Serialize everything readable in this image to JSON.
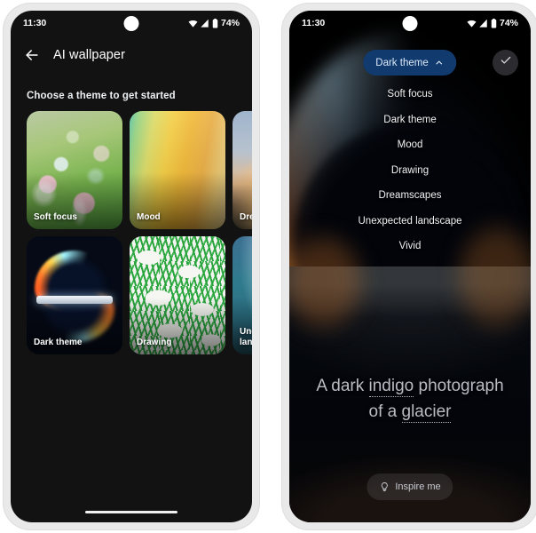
{
  "statusbar": {
    "time": "11:30",
    "battery": "74%",
    "icons": [
      "wifi-icon",
      "signal-icon",
      "battery-icon"
    ]
  },
  "left_phone": {
    "back_label": "back-arrow-icon",
    "title": "AI wallpaper",
    "subtitle": "Choose a theme to get started",
    "cards": [
      {
        "label": "Soft focus",
        "art": "art-soft"
      },
      {
        "label": "Mood",
        "art": "art-mood"
      },
      {
        "label": "Dream",
        "art": "art-dream"
      },
      {
        "label": "Dark theme",
        "art": "art-dark"
      },
      {
        "label": "Drawing",
        "art": "art-drawing"
      },
      {
        "label": "Unexpected\nlandsc",
        "art": "art-unexp"
      }
    ],
    "card_labels": {
      "c0": "Soft focus",
      "c1": "Mood",
      "c2": "Dream",
      "c3": "Dark theme",
      "c4": "Drawing",
      "c5a": "Unexp",
      "c5b": "lands"
    }
  },
  "right_phone": {
    "selected_theme": "Dark theme",
    "chip_icon": "chevron-up-icon",
    "confirm_icon": "check-icon",
    "dropdown_options": [
      "Soft focus",
      "Dark theme",
      "Mood",
      "Drawing",
      "Dreamscapes",
      "Unexpected landscape",
      "Vivid"
    ],
    "prompt": {
      "part1": "A dark ",
      "keyword1": "indigo",
      "part2": " photograph of a ",
      "keyword2": "glacier"
    },
    "inspire_label": "Inspire me",
    "inspire_icon": "lightbulb-icon"
  },
  "colors": {
    "chip_bg": "#113a6e",
    "chip_text": "#dce8f8",
    "screen_bg": "#121212",
    "frame": "#e9e9e9",
    "prompt_text": "#b9bcc4"
  }
}
